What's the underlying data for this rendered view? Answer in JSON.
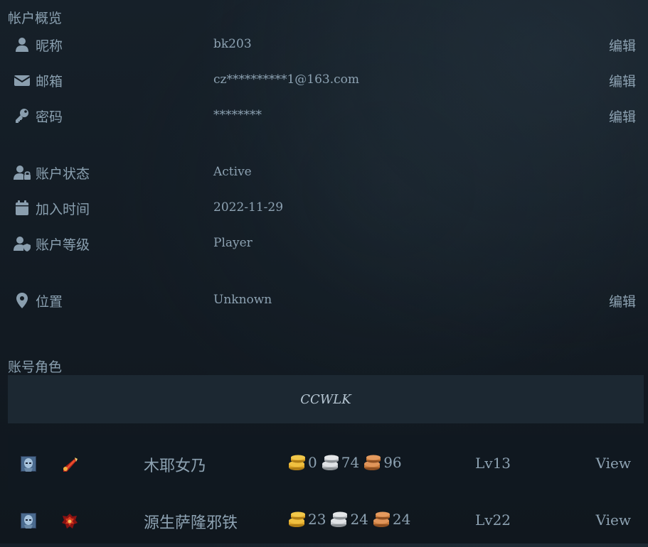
{
  "overview": {
    "title": "帐户概览",
    "rows": [
      {
        "icon": "user-icon",
        "label": "昵称",
        "value": "bk203",
        "edit": "编辑"
      },
      {
        "icon": "envelope-icon",
        "label": "邮箱",
        "value": "cz**********1@163.com",
        "edit": "编辑"
      },
      {
        "icon": "key-icon",
        "label": "密码",
        "value": "********",
        "edit": "编辑"
      },
      {
        "icon": "user-lock-icon",
        "label": "账户状态",
        "value": "Active"
      },
      {
        "icon": "calendar-icon",
        "label": "加入时间",
        "value": "2022-11-29"
      },
      {
        "icon": "user-shield-icon",
        "label": "账户等级",
        "value": "Player"
      },
      {
        "icon": "map-pin-icon",
        "label": "位置",
        "value": "Unknown",
        "edit": "编辑"
      }
    ]
  },
  "characters": {
    "title": "账号角色",
    "realm": "CCWLK",
    "list": [
      {
        "race_icon": "undead-race-icon",
        "class_icon": "shaman-class-icon",
        "name": "木耶女乃",
        "gold": "0",
        "silver": "74",
        "copper": "96",
        "level": "Lv13",
        "view": "View"
      },
      {
        "race_icon": "undead-race-icon",
        "class_icon": "death-knight-class-icon",
        "name": "源生萨隆邪铁",
        "gold": "23",
        "silver": "24",
        "copper": "24",
        "level": "Lv22",
        "view": "View"
      }
    ]
  },
  "colors": {
    "background": "#141c24",
    "text": "#8da2b2",
    "realm_bar": "#1c2832",
    "gold": "#e0a82a",
    "silver": "#c4c8cc",
    "copper": "#c77a3c"
  }
}
